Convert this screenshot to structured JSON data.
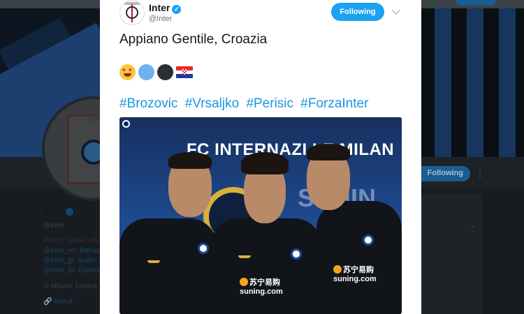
{
  "background_profile": {
    "name": "Inter",
    "handle": "@Inter",
    "following_label": "Following",
    "bio_lines": [
      "Profilo Twitter uffic",
      "@Inter_en: Bahasa",
      "@Inter_jp: Arabic:",
      "@Inter_br: Españo"
    ],
    "location": "Milano, Lomba",
    "url": "inter.it",
    "logo_caption": "CENTO"
  },
  "tweet": {
    "author_name": "Inter",
    "author_handle": "@Inter",
    "follow_button_label": "Following",
    "text": "Appiano Gentile, Croazia",
    "emojis": [
      "heart-eyes-emoji",
      "blue-circle-emoji",
      "black-circle-emoji",
      "croatia-flag-emoji"
    ],
    "hashtags": [
      "#Brozovic",
      "#Vrsaljko",
      "#Perisic",
      "#ForzaInter"
    ]
  },
  "photo": {
    "sign_text": "FC INTERNAZI   LE MILAN",
    "sponsor_text": "苏宁易购",
    "sponsor_sub": "suning.com"
  },
  "colors": {
    "accent": "#1da1f2",
    "hashtag": "#1b95e0",
    "text": "#14171a",
    "muted": "#657786"
  }
}
